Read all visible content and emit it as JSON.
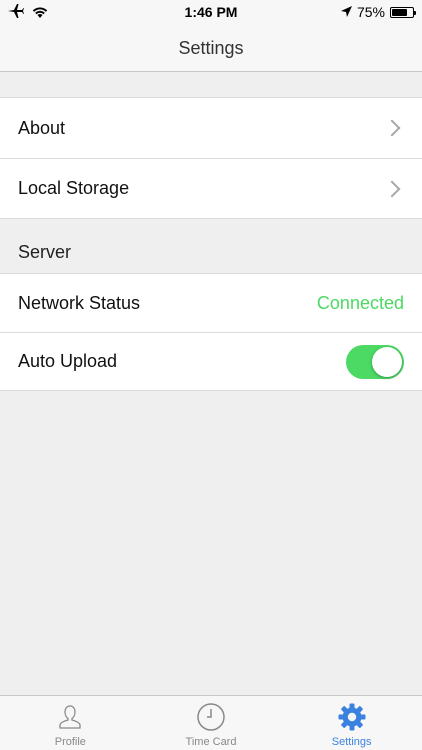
{
  "status_bar": {
    "time": "1:46 PM",
    "battery": "75%",
    "battery_level": 0.75,
    "icons": [
      "airplane-icon",
      "wifi-icon",
      "location-arrow-icon",
      "battery-icon"
    ]
  },
  "nav": {
    "title": "Settings"
  },
  "group1": {
    "items": [
      {
        "label": "About"
      },
      {
        "label": "Local Storage"
      }
    ]
  },
  "server": {
    "header": "Server",
    "network_status_label": "Network Status",
    "network_status_value": "Connected",
    "auto_upload_label": "Auto Upload",
    "auto_upload_on": true
  },
  "colors": {
    "accent": "#3b82e0",
    "connected": "#4cd964",
    "toggle_on": "#4cd964"
  },
  "tabs": [
    {
      "label": "Profile",
      "icon": "profile-icon",
      "active": false
    },
    {
      "label": "Time Card",
      "icon": "clock-icon",
      "active": false
    },
    {
      "label": "Settings",
      "icon": "gear-icon",
      "active": true
    }
  ]
}
